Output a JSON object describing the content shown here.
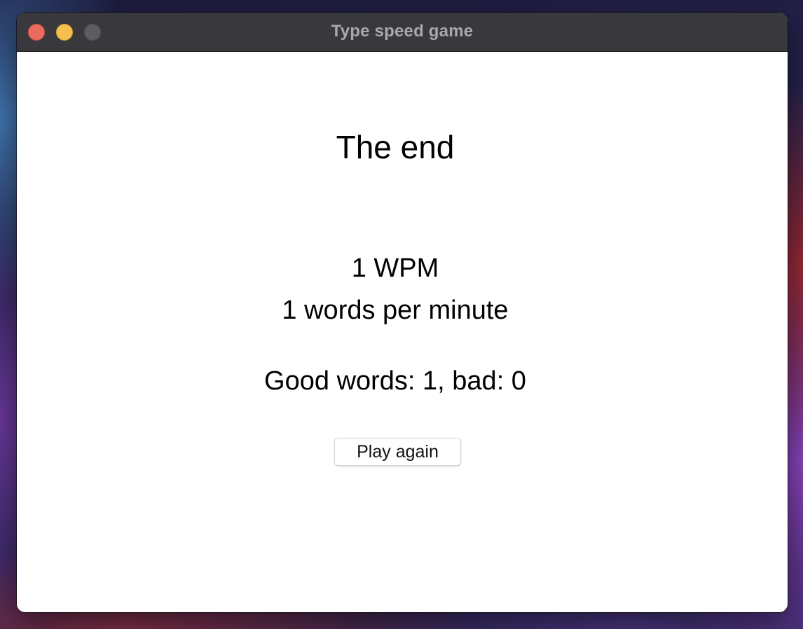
{
  "window": {
    "title": "Type speed game"
  },
  "game": {
    "heading": "The end",
    "wpm_short": "1 WPM",
    "wpm_long": "1 words per minute",
    "score_summary": "Good words: 1, bad: 0",
    "play_again_label": "Play again"
  },
  "colors": {
    "close": "#ec6a5e",
    "minimize": "#f4bf4f",
    "zoom_disabled": "#5d5c60",
    "titlebar": "#39383c"
  }
}
